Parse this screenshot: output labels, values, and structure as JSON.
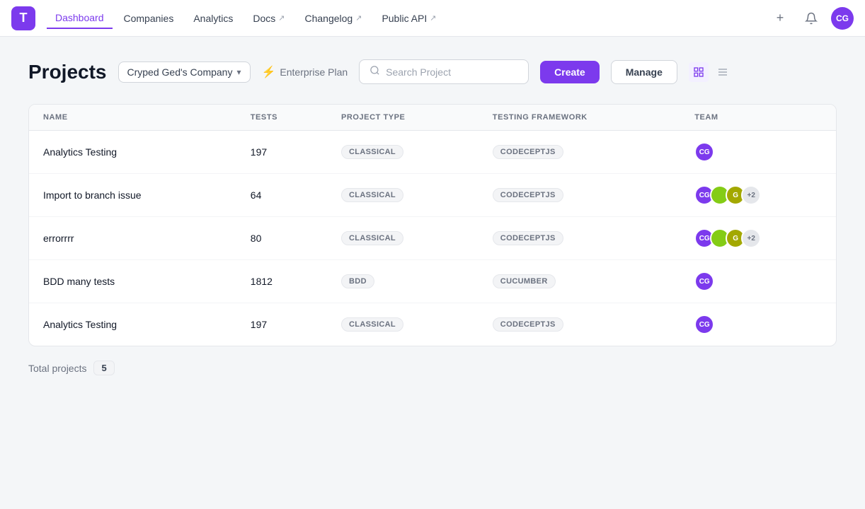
{
  "app": {
    "logo_text": "T",
    "title": "Projects"
  },
  "navbar": {
    "links": [
      {
        "label": "Dashboard",
        "active": true,
        "external": false
      },
      {
        "label": "Companies",
        "active": false,
        "external": false
      },
      {
        "label": "Analytics",
        "active": false,
        "external": false
      },
      {
        "label": "Docs",
        "active": false,
        "external": true
      },
      {
        "label": "Changelog",
        "active": false,
        "external": true
      },
      {
        "label": "Public API",
        "active": false,
        "external": true
      }
    ],
    "add_icon": "+",
    "notification_icon": "🔔",
    "avatar_text": "CG"
  },
  "header": {
    "title": "Projects",
    "company_selector": {
      "label": "Cryped Ged's Company",
      "chevron": "▾"
    },
    "plan": {
      "icon": "⚡",
      "label": "Enterprise Plan"
    },
    "search": {
      "placeholder": "Search Project",
      "icon": "🔍"
    },
    "create_label": "Create",
    "manage_label": "Manage",
    "view_grid_icon": "⊞",
    "view_list_icon": "≡"
  },
  "table": {
    "columns": [
      {
        "key": "name",
        "label": "NAME"
      },
      {
        "key": "tests",
        "label": "TESTS"
      },
      {
        "key": "project_type",
        "label": "PROJECT TYPE"
      },
      {
        "key": "testing_framework",
        "label": "TESTING FRAMEWORK"
      },
      {
        "key": "team",
        "label": "TEAM"
      }
    ],
    "rows": [
      {
        "name": "Analytics Testing",
        "tests": "197",
        "project_type": "CLASSICAL",
        "testing_framework": "CODECEPTJS",
        "team": [
          {
            "text": "CG",
            "color": "#7c3aed"
          }
        ]
      },
      {
        "name": "Import to branch issue",
        "tests": "64",
        "project_type": "CLASSICAL",
        "testing_framework": "CODECEPTJS",
        "team": [
          {
            "text": "CG",
            "color": "#7c3aed"
          },
          {
            "text": "",
            "color": "#84cc16"
          },
          {
            "text": "G",
            "color": "#a3a800"
          },
          {
            "extra": "+2"
          }
        ]
      },
      {
        "name": "errorrrr",
        "tests": "80",
        "project_type": "CLASSICAL",
        "testing_framework": "CODECEPTJS",
        "team": [
          {
            "text": "CG",
            "color": "#7c3aed"
          },
          {
            "text": "",
            "color": "#84cc16"
          },
          {
            "text": "G",
            "color": "#a3a800"
          },
          {
            "extra": "+2"
          }
        ]
      },
      {
        "name": "BDD many tests",
        "tests": "1812",
        "project_type": "BDD",
        "testing_framework": "CUCUMBER",
        "team": [
          {
            "text": "CG",
            "color": "#7c3aed"
          }
        ]
      },
      {
        "name": "Analytics Testing",
        "tests": "197",
        "project_type": "CLASSICAL",
        "testing_framework": "CODECEPTJS",
        "team": [
          {
            "text": "CG",
            "color": "#7c3aed"
          }
        ]
      }
    ]
  },
  "footer": {
    "label": "Total projects",
    "count": "5"
  }
}
